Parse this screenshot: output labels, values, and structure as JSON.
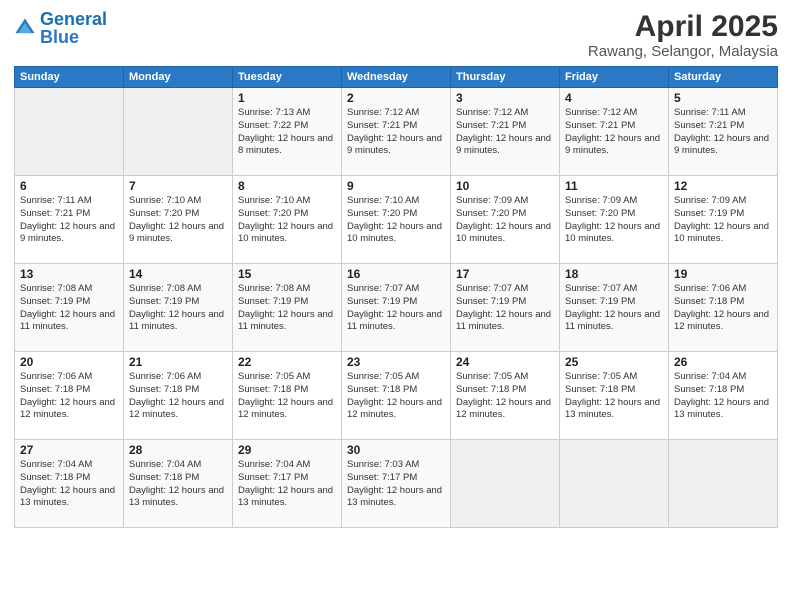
{
  "logo": {
    "text_general": "General",
    "text_blue": "Blue"
  },
  "title": "April 2025",
  "subtitle": "Rawang, Selangor, Malaysia",
  "headers": [
    "Sunday",
    "Monday",
    "Tuesday",
    "Wednesday",
    "Thursday",
    "Friday",
    "Saturday"
  ],
  "weeks": [
    [
      {
        "day": "",
        "sunrise": "",
        "sunset": "",
        "daylight": ""
      },
      {
        "day": "",
        "sunrise": "",
        "sunset": "",
        "daylight": ""
      },
      {
        "day": "1",
        "sunrise": "Sunrise: 7:13 AM",
        "sunset": "Sunset: 7:22 PM",
        "daylight": "Daylight: 12 hours and 8 minutes."
      },
      {
        "day": "2",
        "sunrise": "Sunrise: 7:12 AM",
        "sunset": "Sunset: 7:21 PM",
        "daylight": "Daylight: 12 hours and 9 minutes."
      },
      {
        "day": "3",
        "sunrise": "Sunrise: 7:12 AM",
        "sunset": "Sunset: 7:21 PM",
        "daylight": "Daylight: 12 hours and 9 minutes."
      },
      {
        "day": "4",
        "sunrise": "Sunrise: 7:12 AM",
        "sunset": "Sunset: 7:21 PM",
        "daylight": "Daylight: 12 hours and 9 minutes."
      },
      {
        "day": "5",
        "sunrise": "Sunrise: 7:11 AM",
        "sunset": "Sunset: 7:21 PM",
        "daylight": "Daylight: 12 hours and 9 minutes."
      }
    ],
    [
      {
        "day": "6",
        "sunrise": "Sunrise: 7:11 AM",
        "sunset": "Sunset: 7:21 PM",
        "daylight": "Daylight: 12 hours and 9 minutes."
      },
      {
        "day": "7",
        "sunrise": "Sunrise: 7:10 AM",
        "sunset": "Sunset: 7:20 PM",
        "daylight": "Daylight: 12 hours and 9 minutes."
      },
      {
        "day": "8",
        "sunrise": "Sunrise: 7:10 AM",
        "sunset": "Sunset: 7:20 PM",
        "daylight": "Daylight: 12 hours and 10 minutes."
      },
      {
        "day": "9",
        "sunrise": "Sunrise: 7:10 AM",
        "sunset": "Sunset: 7:20 PM",
        "daylight": "Daylight: 12 hours and 10 minutes."
      },
      {
        "day": "10",
        "sunrise": "Sunrise: 7:09 AM",
        "sunset": "Sunset: 7:20 PM",
        "daylight": "Daylight: 12 hours and 10 minutes."
      },
      {
        "day": "11",
        "sunrise": "Sunrise: 7:09 AM",
        "sunset": "Sunset: 7:20 PM",
        "daylight": "Daylight: 12 hours and 10 minutes."
      },
      {
        "day": "12",
        "sunrise": "Sunrise: 7:09 AM",
        "sunset": "Sunset: 7:19 PM",
        "daylight": "Daylight: 12 hours and 10 minutes."
      }
    ],
    [
      {
        "day": "13",
        "sunrise": "Sunrise: 7:08 AM",
        "sunset": "Sunset: 7:19 PM",
        "daylight": "Daylight: 12 hours and 11 minutes."
      },
      {
        "day": "14",
        "sunrise": "Sunrise: 7:08 AM",
        "sunset": "Sunset: 7:19 PM",
        "daylight": "Daylight: 12 hours and 11 minutes."
      },
      {
        "day": "15",
        "sunrise": "Sunrise: 7:08 AM",
        "sunset": "Sunset: 7:19 PM",
        "daylight": "Daylight: 12 hours and 11 minutes."
      },
      {
        "day": "16",
        "sunrise": "Sunrise: 7:07 AM",
        "sunset": "Sunset: 7:19 PM",
        "daylight": "Daylight: 12 hours and 11 minutes."
      },
      {
        "day": "17",
        "sunrise": "Sunrise: 7:07 AM",
        "sunset": "Sunset: 7:19 PM",
        "daylight": "Daylight: 12 hours and 11 minutes."
      },
      {
        "day": "18",
        "sunrise": "Sunrise: 7:07 AM",
        "sunset": "Sunset: 7:19 PM",
        "daylight": "Daylight: 12 hours and 11 minutes."
      },
      {
        "day": "19",
        "sunrise": "Sunrise: 7:06 AM",
        "sunset": "Sunset: 7:18 PM",
        "daylight": "Daylight: 12 hours and 12 minutes."
      }
    ],
    [
      {
        "day": "20",
        "sunrise": "Sunrise: 7:06 AM",
        "sunset": "Sunset: 7:18 PM",
        "daylight": "Daylight: 12 hours and 12 minutes."
      },
      {
        "day": "21",
        "sunrise": "Sunrise: 7:06 AM",
        "sunset": "Sunset: 7:18 PM",
        "daylight": "Daylight: 12 hours and 12 minutes."
      },
      {
        "day": "22",
        "sunrise": "Sunrise: 7:05 AM",
        "sunset": "Sunset: 7:18 PM",
        "daylight": "Daylight: 12 hours and 12 minutes."
      },
      {
        "day": "23",
        "sunrise": "Sunrise: 7:05 AM",
        "sunset": "Sunset: 7:18 PM",
        "daylight": "Daylight: 12 hours and 12 minutes."
      },
      {
        "day": "24",
        "sunrise": "Sunrise: 7:05 AM",
        "sunset": "Sunset: 7:18 PM",
        "daylight": "Daylight: 12 hours and 12 minutes."
      },
      {
        "day": "25",
        "sunrise": "Sunrise: 7:05 AM",
        "sunset": "Sunset: 7:18 PM",
        "daylight": "Daylight: 12 hours and 13 minutes."
      },
      {
        "day": "26",
        "sunrise": "Sunrise: 7:04 AM",
        "sunset": "Sunset: 7:18 PM",
        "daylight": "Daylight: 12 hours and 13 minutes."
      }
    ],
    [
      {
        "day": "27",
        "sunrise": "Sunrise: 7:04 AM",
        "sunset": "Sunset: 7:18 PM",
        "daylight": "Daylight: 12 hours and 13 minutes."
      },
      {
        "day": "28",
        "sunrise": "Sunrise: 7:04 AM",
        "sunset": "Sunset: 7:18 PM",
        "daylight": "Daylight: 12 hours and 13 minutes."
      },
      {
        "day": "29",
        "sunrise": "Sunrise: 7:04 AM",
        "sunset": "Sunset: 7:17 PM",
        "daylight": "Daylight: 12 hours and 13 minutes."
      },
      {
        "day": "30",
        "sunrise": "Sunrise: 7:03 AM",
        "sunset": "Sunset: 7:17 PM",
        "daylight": "Daylight: 12 hours and 13 minutes."
      },
      {
        "day": "",
        "sunrise": "",
        "sunset": "",
        "daylight": ""
      },
      {
        "day": "",
        "sunrise": "",
        "sunset": "",
        "daylight": ""
      },
      {
        "day": "",
        "sunrise": "",
        "sunset": "",
        "daylight": ""
      }
    ]
  ]
}
